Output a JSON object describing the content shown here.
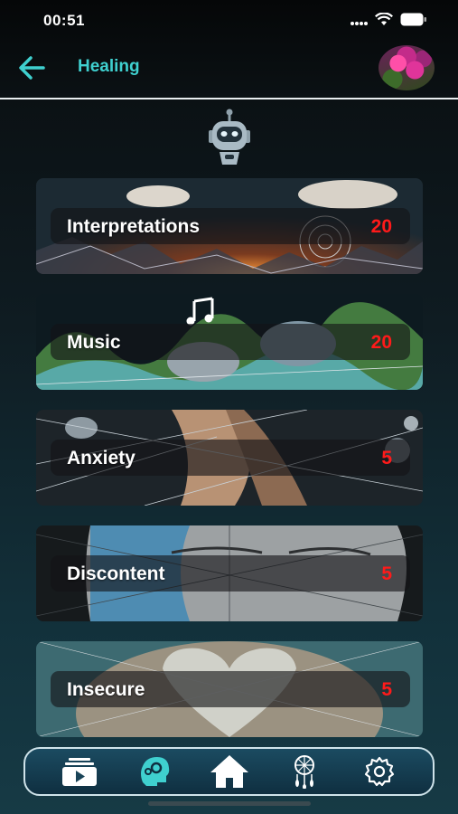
{
  "status_bar": {
    "time": "00:51"
  },
  "header": {
    "title": "Healing",
    "back_icon": "arrow-left-icon",
    "avatar_icon": "flower-avatar"
  },
  "accent_color": "#3fd0cf",
  "count_color": "#ff1a1a",
  "categories": [
    {
      "label": "Interpretations",
      "count": "20"
    },
    {
      "label": "Music",
      "count": "20"
    },
    {
      "label": "Anxiety",
      "count": "5"
    },
    {
      "label": "Discontent",
      "count": "5"
    },
    {
      "label": "Insecure",
      "count": "5"
    }
  ],
  "bottom_nav": [
    {
      "icon": "video-library-icon"
    },
    {
      "icon": "brain-gear-icon",
      "active": true
    },
    {
      "icon": "home-icon"
    },
    {
      "icon": "dreamcatcher-icon"
    },
    {
      "icon": "settings-gear-icon"
    }
  ]
}
